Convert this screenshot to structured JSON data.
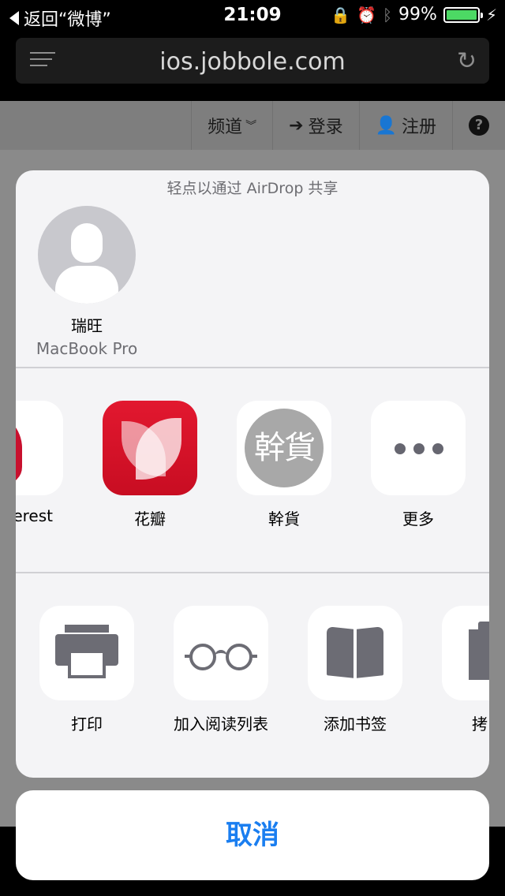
{
  "status_bar": {
    "back_label": "返回“微博”",
    "time": "21:09",
    "battery": "99%",
    "battery_level": 0.99
  },
  "browser": {
    "url": "ios.jobbole.com"
  },
  "site_nav": {
    "channels": "频道",
    "login": "登录",
    "register": "注册",
    "help": "?"
  },
  "share_sheet": {
    "airdrop_title": "轻点以通过 AirDrop 共享",
    "contact": {
      "name": "瑞旺",
      "device": "MacBook Pro"
    },
    "apps": [
      {
        "label": "erest",
        "icon": "pinterest-icon"
      },
      {
        "label": "花瓣",
        "icon": "huaban-icon"
      },
      {
        "label": "幹貨",
        "icon": "ganhuo-icon",
        "icon_text": "幹貨"
      },
      {
        "label": "更多",
        "icon": "more-icon"
      }
    ],
    "actions": [
      {
        "label": "打印",
        "icon": "printer-icon"
      },
      {
        "label": "加入阅读列表",
        "icon": "glasses-icon"
      },
      {
        "label": "添加书签",
        "icon": "book-icon"
      },
      {
        "label": "拷",
        "icon": "copy-icon"
      }
    ],
    "cancel_label": "取消"
  }
}
